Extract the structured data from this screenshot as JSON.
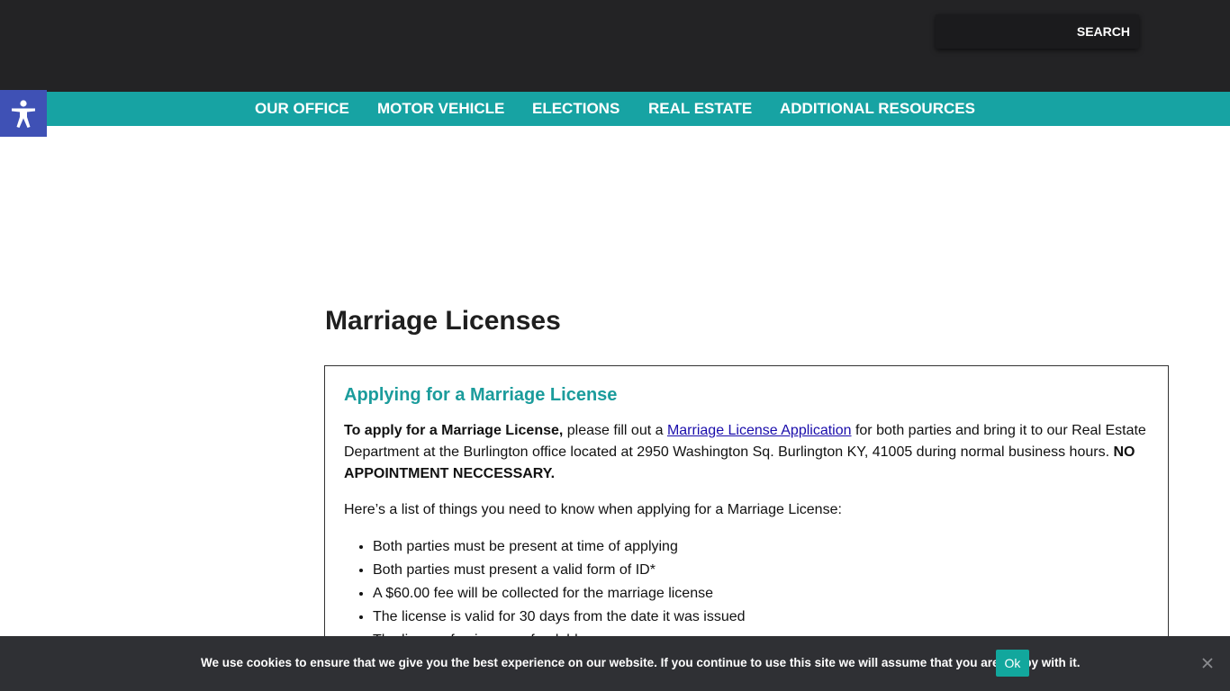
{
  "header": {
    "search": {
      "placeholder": "",
      "button_label": "SEARCH"
    }
  },
  "nav": {
    "items": [
      {
        "label": "OUR OFFICE"
      },
      {
        "label": "MOTOR VEHICLE"
      },
      {
        "label": "ELECTIONS"
      },
      {
        "label": "REAL ESTATE"
      },
      {
        "label": "ADDITIONAL RESOURCES"
      }
    ]
  },
  "accessibility": {
    "icon": "accessibility-icon"
  },
  "main": {
    "title": "Marriage Licenses",
    "section": {
      "heading": "Applying for a Marriage License",
      "intro_bold": "To apply for a Marriage License,",
      "intro_text_1": " please fill out a ",
      "intro_link": "Marriage License Application",
      "intro_text_2": " for both parties and bring it to our Real Estate Department at the Burlington office located at 2950 Washington Sq. Burlington KY, 41005 during normal business hours. ",
      "intro_bold_end": "NO APPOINTMENT NECCESSARY.",
      "list_intro": "Here’s a list of things you need to know when applying for a Marriage License:",
      "bullets": [
        "Both parties must be present at time of applying",
        "Both parties must present a valid form of ID*",
        "A $60.00 fee will be collected for the marriage license",
        "The license is valid for 30 days from the date it was issued",
        "The license fee is non-refundable"
      ]
    }
  },
  "cookie_bar": {
    "message": "We use cookies to ensure that we give you the best experience on our website. If you continue to use this site we will assume that you are happy with it.",
    "ok_label": "Ok"
  },
  "colors": {
    "topbar": "#232325",
    "nav": "#17a3a3",
    "accent_heading": "#1b9c9c",
    "accessibility_button": "#3f51b5",
    "cookie_bar": "#2f3034",
    "cookie_ok": "#12a79d"
  }
}
